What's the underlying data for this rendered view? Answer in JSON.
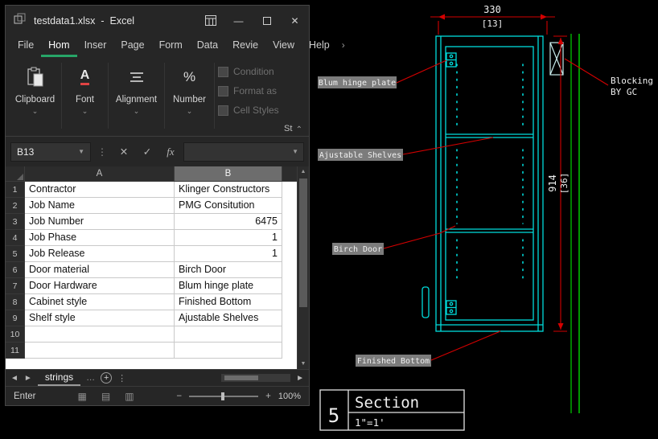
{
  "colors": {
    "excel_accent_green": "#27a567",
    "font_red_bar": "#e04343",
    "cad_cyan": "#00dcdc",
    "cad_red": "#d40000",
    "cad_green": "#00c800",
    "cad_label_bg": "#7c7c7c"
  },
  "excel": {
    "titlebar": {
      "title": "testdata1.xlsx  -  Excel"
    },
    "menu": {
      "file": "File",
      "home": "Hom",
      "insert": "Inser",
      "page": "Page",
      "form": "Form",
      "data": "Data",
      "review": "Revie",
      "view": "View",
      "help": "Help",
      "overflow": "›"
    },
    "ribbon": {
      "clipboard": "Clipboard",
      "font": "Font",
      "alignment": "Alignment",
      "number": "Number",
      "conditional": "Condition",
      "format_as": "Format as",
      "cell_styles": "Cell Styles",
      "styles_partial": "St"
    },
    "formula_bar": {
      "name_box": "B13",
      "fx": "fx"
    },
    "grid": {
      "col_a": "A",
      "col_b": "B",
      "rows": [
        {
          "num": "1",
          "a": "Contractor",
          "b": "Klinger Constructors"
        },
        {
          "num": "2",
          "a": "Job Name",
          "b": "PMG Consitution"
        },
        {
          "num": "3",
          "a": "Job Number",
          "b": "6475"
        },
        {
          "num": "4",
          "a": "Job Phase",
          "b": "1"
        },
        {
          "num": "5",
          "a": "Job Release",
          "b": "1"
        },
        {
          "num": "6",
          "a": "Door material",
          "b": "Birch Door"
        },
        {
          "num": "7",
          "a": "Door Hardware",
          "b": "Blum hinge plate"
        },
        {
          "num": "8",
          "a": "Cabinet style",
          "b": "Finished Bottom"
        },
        {
          "num": "9",
          "a": "Shelf style",
          "b": "Ajustable Shelves"
        },
        {
          "num": "10",
          "a": "",
          "b": ""
        },
        {
          "num": "11",
          "a": "",
          "b": ""
        }
      ]
    },
    "tabs": {
      "sheet": "strings",
      "more": "…"
    },
    "status": {
      "mode": "Enter",
      "zoom": "100%"
    }
  },
  "cad": {
    "dim_width": "330",
    "dim_width_alt": "[13]",
    "dim_height": "914",
    "dim_height_alt": "[36]",
    "label_hinge": "Blum hinge plate",
    "label_shelves": "Ajustable Shelves",
    "label_door": "Birch Door",
    "label_bottom": "Finished Bottom",
    "blocking_line1": "Blocking",
    "blocking_line2": "BY GC",
    "titleblock": {
      "number": "5",
      "name": "Section",
      "scale": "1\"=1'"
    }
  }
}
